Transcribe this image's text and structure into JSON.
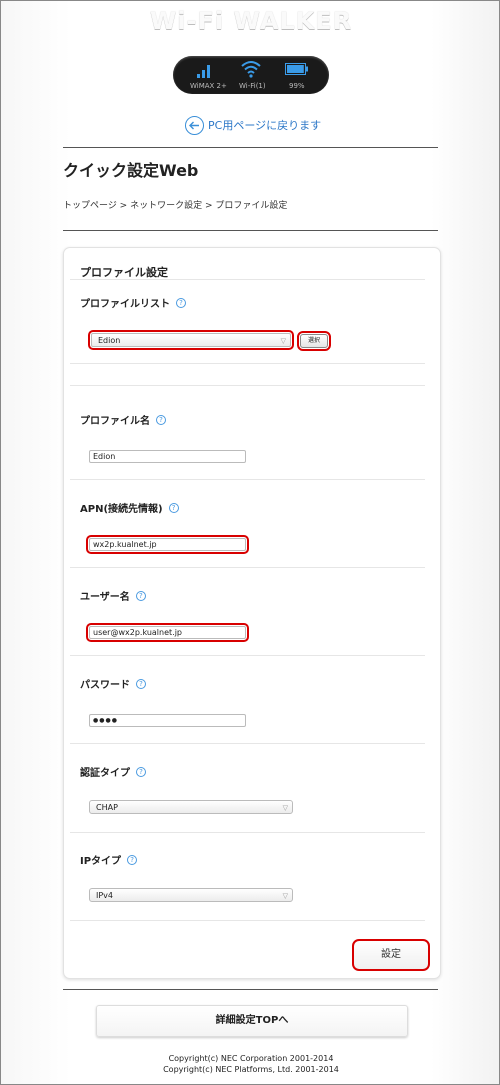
{
  "header": {
    "brand": "Wi-Fi WALKER",
    "status": {
      "wimax_label": "WiMAX 2+",
      "wifi_label": "Wi-Fi(1)",
      "battery_label": "99%",
      "battery_level": 0.99
    },
    "back_link": "PC用ページに戻ります"
  },
  "page": {
    "title": "クイック設定Web",
    "breadcrumb": "トップページ > ネットワーク設定 > プロファイル設定"
  },
  "form": {
    "section_title": "プロファイル設定",
    "profile_list": {
      "label": "プロファイルリスト",
      "value": "Edion",
      "select_button": "選択"
    },
    "profile_name": {
      "label": "プロファイル名",
      "value": "Edion"
    },
    "apn": {
      "label": "APN(接続先情報)",
      "value": "wx2p.kualnet.jp"
    },
    "username": {
      "label": "ユーザー名",
      "value": "user@wx2p.kualnet.jp"
    },
    "password": {
      "label": "パスワード",
      "value": "●●●●"
    },
    "auth_type": {
      "label": "認証タイプ",
      "value": "CHAP"
    },
    "ip_type": {
      "label": "IPタイプ",
      "value": "IPv4"
    },
    "submit": "設定",
    "help_glyph": "?"
  },
  "footer": {
    "detail_button": "詳細設定TOPへ",
    "copyright_1": "Copyright(c) NEC Corporation 2001-2014",
    "copyright_2": "Copyright(c) NEC Platforms, Ltd. 2001-2014"
  },
  "colors": {
    "accent_blue": "#3a8fd8",
    "highlight_red": "#d80000"
  }
}
